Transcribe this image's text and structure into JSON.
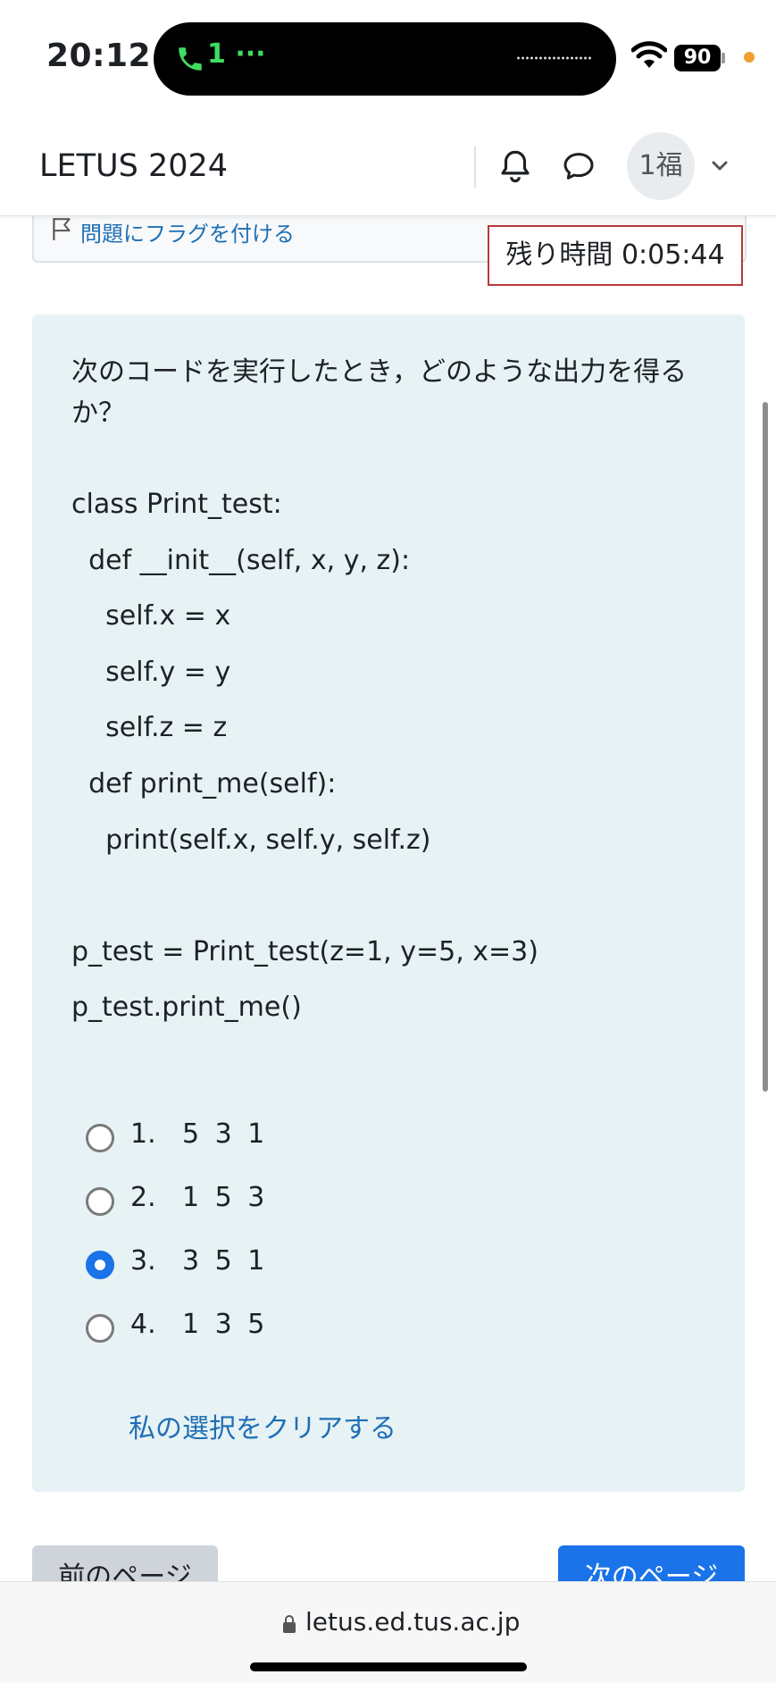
{
  "status": {
    "time": "20:12",
    "call_label": "1 ···",
    "battery": "90"
  },
  "nav": {
    "brand": "LETUS 2024",
    "avatar": "1福"
  },
  "question": {
    "flag_label": "問題にフラグを付ける",
    "timer": "残り時間 0:05:44",
    "prompt": "次のコードを実行したとき，どのような出力を得るか？",
    "code_lines": [
      "class Print_test:",
      "  def __init__(self, x, y, z):",
      "    self.x = x",
      "    self.y = y",
      "    self.z = z",
      "  def print_me(self):",
      "    print(self.x, self.y, self.z)",
      "",
      "p_test = Print_test(z=1, y=5, x=3)",
      "p_test.print_me()"
    ],
    "answers": [
      {
        "num": "1.",
        "value": "5 3 1",
        "selected": false
      },
      {
        "num": "2.",
        "value": "1 5 3",
        "selected": false
      },
      {
        "num": "3.",
        "value": "3 5 1",
        "selected": true
      },
      {
        "num": "4.",
        "value": "1 3 5",
        "selected": false
      }
    ],
    "clear_label": "私の選択をクリアする"
  },
  "footer": {
    "prev_label": "前のページ",
    "next_label": "次のページ"
  },
  "browser": {
    "url": "letus.ed.tus.ac.jp"
  },
  "colors": {
    "accent": "#1a73e8",
    "link": "#1f6fb5",
    "question_bg": "#e7f2f5",
    "timer_border": "#b83a3a"
  },
  "icons": [
    "phone-icon",
    "wifi-icon",
    "bell-icon",
    "chat-icon",
    "chevron-down-icon",
    "flag-icon",
    "lock-icon"
  ]
}
